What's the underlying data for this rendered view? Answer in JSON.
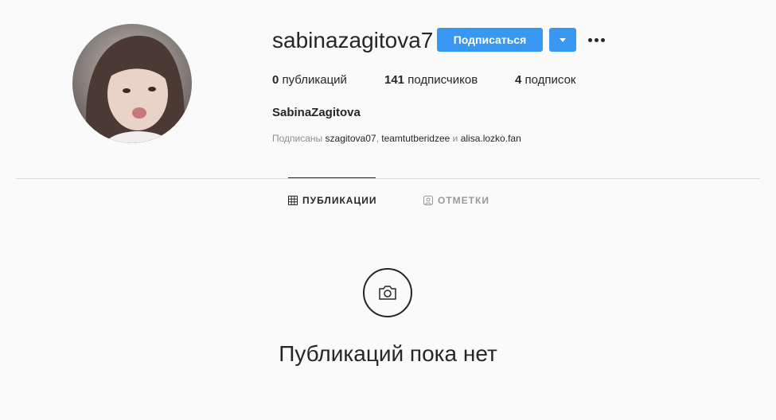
{
  "profile": {
    "username": "sabinazagitova7",
    "full_name": "SabinaZagitova",
    "avatar_icon": "profile-photo"
  },
  "actions": {
    "follow_label": "Подписаться",
    "dropdown_icon": "triangle-down-icon",
    "more_icon": "ellipsis-icon",
    "accent_color": "#3897f0"
  },
  "stats": {
    "posts_count": "0",
    "posts_label": "публикаций",
    "followers_count": "141",
    "followers_label": "подписчиков",
    "following_count": "4",
    "following_label": "подписок"
  },
  "followed_by": {
    "prefix": "Подписаны",
    "user1": "szagitova07",
    "separator": ",",
    "user2": "teamtutberidzee",
    "conjunction": "и",
    "user3": "alisa.lozko.fan"
  },
  "tabs": [
    {
      "label": "ПУБЛИКАЦИИ",
      "icon": "grid-icon",
      "active": true
    },
    {
      "label": "ОТМЕТКИ",
      "icon": "tagged-user-icon",
      "active": false
    }
  ],
  "empty_state": {
    "icon": "camera-icon",
    "message": "Публикаций пока нет"
  }
}
